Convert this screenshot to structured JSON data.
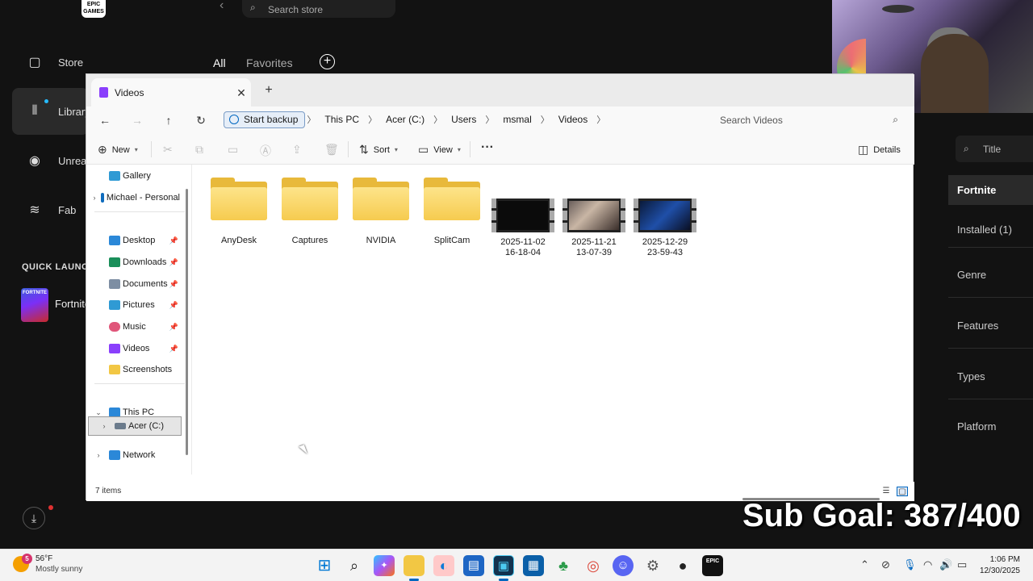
{
  "epic": {
    "logo_text": "EPIC GAMES",
    "search_placeholder": "Search store",
    "nav": {
      "store": "Store",
      "library": "Library",
      "unreal": "Unreal",
      "fab": "Fab"
    },
    "quick_launch": "QUICK LAUNCH",
    "quick_launch_game": "Fortnite",
    "quick_launch_thumb_text": "FORTNITE",
    "tabs": {
      "all": "All",
      "favorites": "Favorites"
    },
    "filter": {
      "search_placeholder": "Title",
      "selected": "Fortnite",
      "items": [
        "Installed (1)",
        "Genre",
        "Features",
        "Types",
        "Platform"
      ]
    }
  },
  "explorer": {
    "tab_title": "Videos",
    "breadcrumb": {
      "backup": "Start backup",
      "parts": [
        "This PC",
        "Acer (C:)",
        "Users",
        "msmal",
        "Videos"
      ]
    },
    "search_placeholder": "Search Videos",
    "toolbar": {
      "new": "New",
      "sort": "Sort",
      "view": "View",
      "details": "Details"
    },
    "nav_pane": {
      "gallery": "Gallery",
      "onedrive": "Michael - Personal",
      "quick_access": [
        {
          "label": "Desktop",
          "color": "#2b88d8"
        },
        {
          "label": "Downloads",
          "color": "#1a8f5a"
        },
        {
          "label": "Documents",
          "color": "#7d8ea3"
        },
        {
          "label": "Pictures",
          "color": "#2f9ad4"
        },
        {
          "label": "Music",
          "color": "#e0567a"
        },
        {
          "label": "Videos",
          "color": "#8a3ffc"
        },
        {
          "label": "Screenshots",
          "color": "#f2c744"
        }
      ],
      "this_pc": "This PC",
      "drive": "Acer (C:)",
      "network": "Network"
    },
    "items": [
      {
        "type": "folder",
        "label": "AnyDesk"
      },
      {
        "type": "folder",
        "label": "Captures"
      },
      {
        "type": "folder",
        "label": "NVIDIA"
      },
      {
        "type": "folder",
        "label": "SplitCam"
      },
      {
        "type": "video",
        "line1": "2025-11-02",
        "line2": "16-18-04"
      },
      {
        "type": "video",
        "line1": "2025-11-21",
        "line2": "13-07-39"
      },
      {
        "type": "video",
        "line1": "2025-12-29",
        "line2": "23-59-43"
      }
    ],
    "status": "7 items"
  },
  "overlay": {
    "sub_goal": "Sub Goal: 387/400"
  },
  "taskbar": {
    "weather_temp": "56°F",
    "weather_cond": "Mostly sunny",
    "weather_badge": "5",
    "time": "1:06 PM",
    "date": "12/30/2025"
  }
}
